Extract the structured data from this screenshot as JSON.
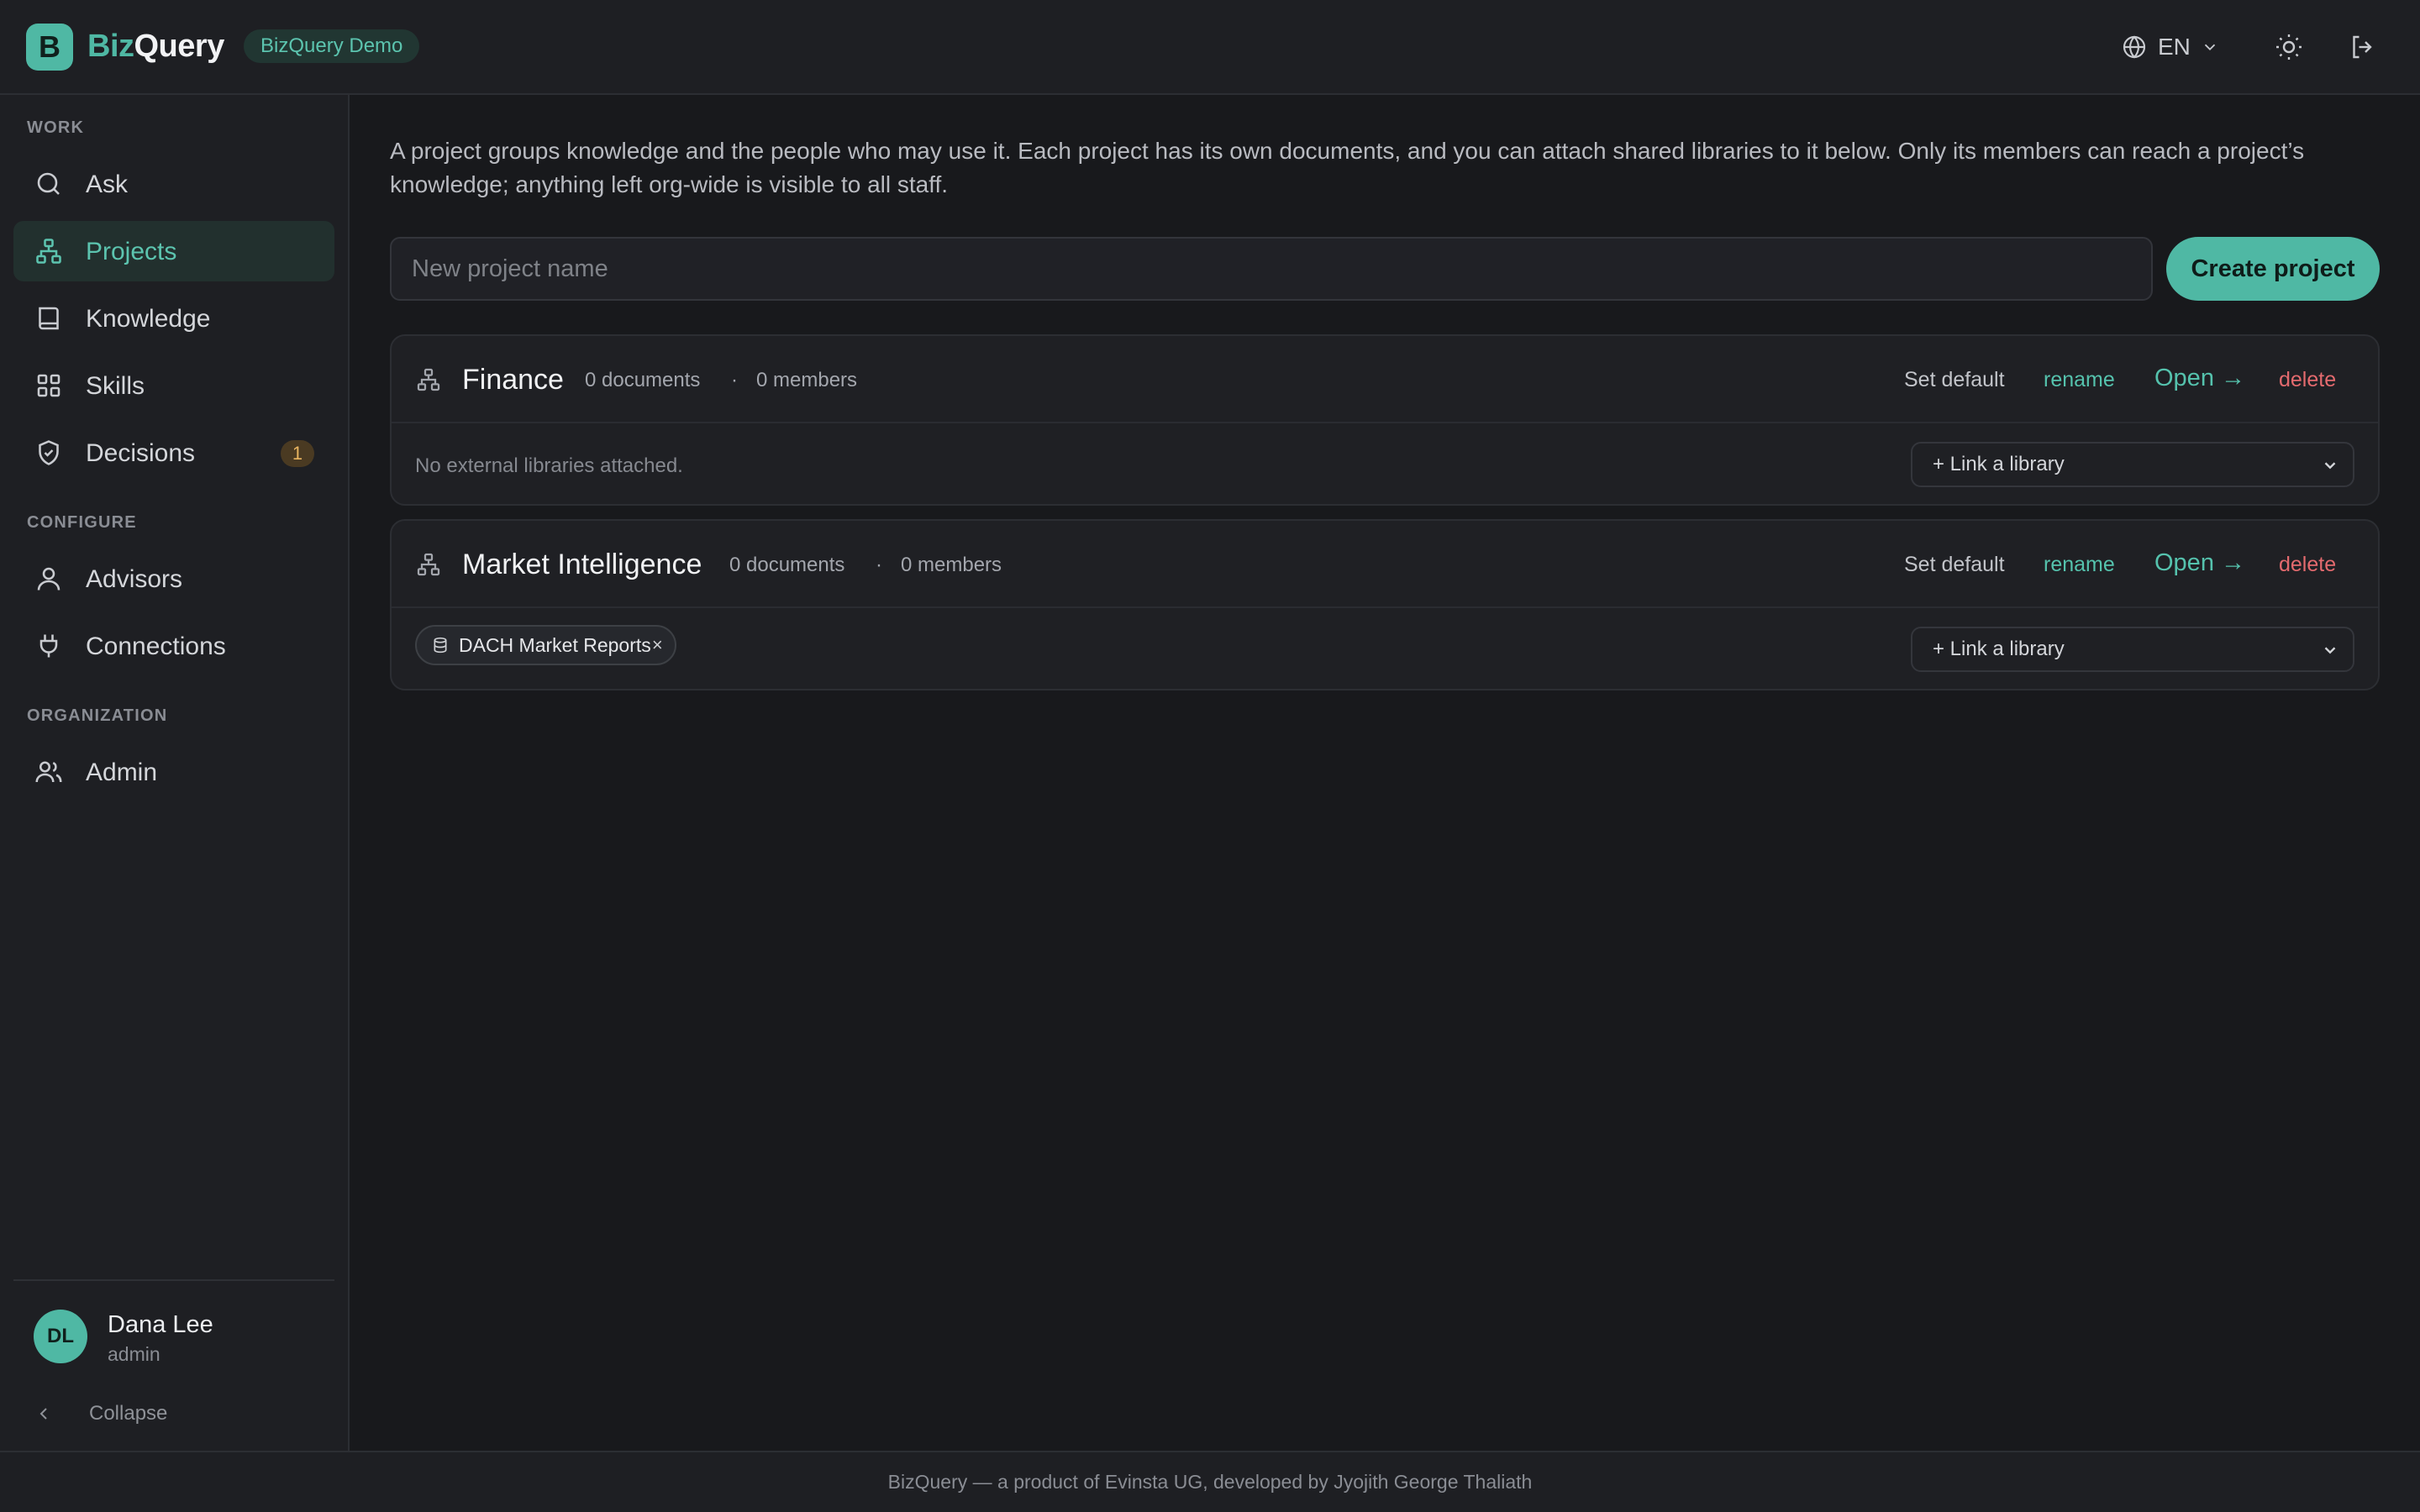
{
  "header": {
    "brand_part1": "Biz",
    "brand_part2": "Query",
    "logo_letter": "B",
    "demo_badge": "BizQuery Demo",
    "language": "EN"
  },
  "sidebar": {
    "sections": [
      {
        "label": "WORK"
      },
      {
        "label": "CONFIGURE"
      },
      {
        "label": "ORGANIZATION"
      }
    ],
    "items": [
      {
        "label": "Ask",
        "icon": "search-icon"
      },
      {
        "label": "Projects",
        "icon": "projects-icon",
        "active": true
      },
      {
        "label": "Knowledge",
        "icon": "book-icon"
      },
      {
        "label": "Skills",
        "icon": "grid-icon"
      },
      {
        "label": "Decisions",
        "icon": "shield-check-icon",
        "badge": "1"
      },
      {
        "label": "Advisors",
        "icon": "user-icon"
      },
      {
        "label": "Connections",
        "icon": "plug-icon"
      },
      {
        "label": "Admin",
        "icon": "users-icon"
      }
    ],
    "user": {
      "initials": "DL",
      "name": "Dana Lee",
      "role": "admin"
    },
    "collapse_label": "Collapse"
  },
  "main": {
    "intro": "A project groups knowledge and the people who may use it. Each project has its own documents, and you can attach shared libraries to it below. Only its members can reach a project’s knowledge; anything left org-wide is visible to all staff.",
    "new_project_placeholder": "New project name",
    "create_button": "Create project",
    "projects": [
      {
        "name": "Finance",
        "documents": "0 documents",
        "separator": "·",
        "members": "0 members",
        "set_default": "Set default",
        "rename": "rename",
        "open": "Open →",
        "delete": "delete",
        "libraries_empty": "No external libraries attached.",
        "link_library": "+ Link a library"
      },
      {
        "name": "Market Intelligence",
        "documents": "0 documents",
        "separator": "·",
        "members": "0 members",
        "set_default": "Set default",
        "rename": "rename",
        "open": "Open →",
        "delete": "delete",
        "library_chip": "DACH Market Reports",
        "chip_remove": "×",
        "link_library": "+ Link a library"
      }
    ]
  },
  "footer": {
    "text": "BizQuery — a product of Evinsta UG, developed by Jyojith George Thaliath"
  },
  "colors": {
    "accent": "#4fb8a4",
    "danger": "#e36a6e",
    "background": "#18191c",
    "panel": "#1e1f23",
    "badge_warning": "#e8b460"
  }
}
